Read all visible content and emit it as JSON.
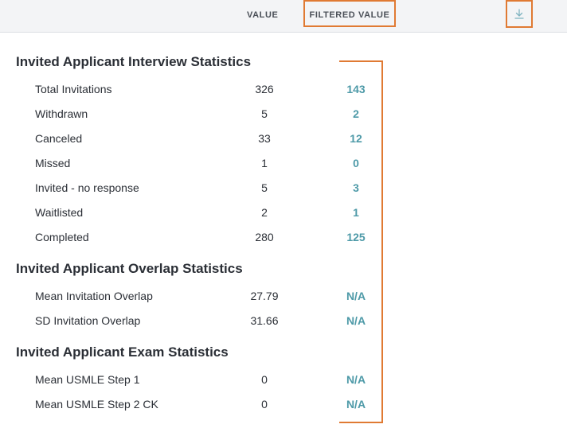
{
  "header": {
    "value_label": "VALUE",
    "filtered_label": "FILTERED VALUE",
    "download_icon": "download-icon",
    "highlight_color": "#e07a33"
  },
  "sections": [
    {
      "title": "Invited Applicant Interview Statistics",
      "rows": [
        {
          "label": "Total Invitations",
          "value": "326",
          "filtered": "143"
        },
        {
          "label": "Withdrawn",
          "value": "5",
          "filtered": "2"
        },
        {
          "label": "Canceled",
          "value": "33",
          "filtered": "12"
        },
        {
          "label": "Missed",
          "value": "1",
          "filtered": "0"
        },
        {
          "label": "Invited - no response",
          "value": "5",
          "filtered": "3"
        },
        {
          "label": "Waitlisted",
          "value": "2",
          "filtered": "1"
        },
        {
          "label": "Completed",
          "value": "280",
          "filtered": "125"
        }
      ]
    },
    {
      "title": "Invited Applicant Overlap Statistics",
      "rows": [
        {
          "label": "Mean Invitation Overlap",
          "value": "27.79",
          "filtered": "N/A"
        },
        {
          "label": "SD Invitation Overlap",
          "value": "31.66",
          "filtered": "N/A"
        }
      ]
    },
    {
      "title": "Invited Applicant Exam Statistics",
      "rows": [
        {
          "label": "Mean USMLE Step 1",
          "value": "0",
          "filtered": "N/A"
        },
        {
          "label": "Mean USMLE Step 2 CK",
          "value": "0",
          "filtered": "N/A"
        }
      ]
    }
  ],
  "colors": {
    "accent_teal": "#4e9aa8",
    "highlight_orange": "#e07a33",
    "header_bg": "#f3f4f6"
  }
}
